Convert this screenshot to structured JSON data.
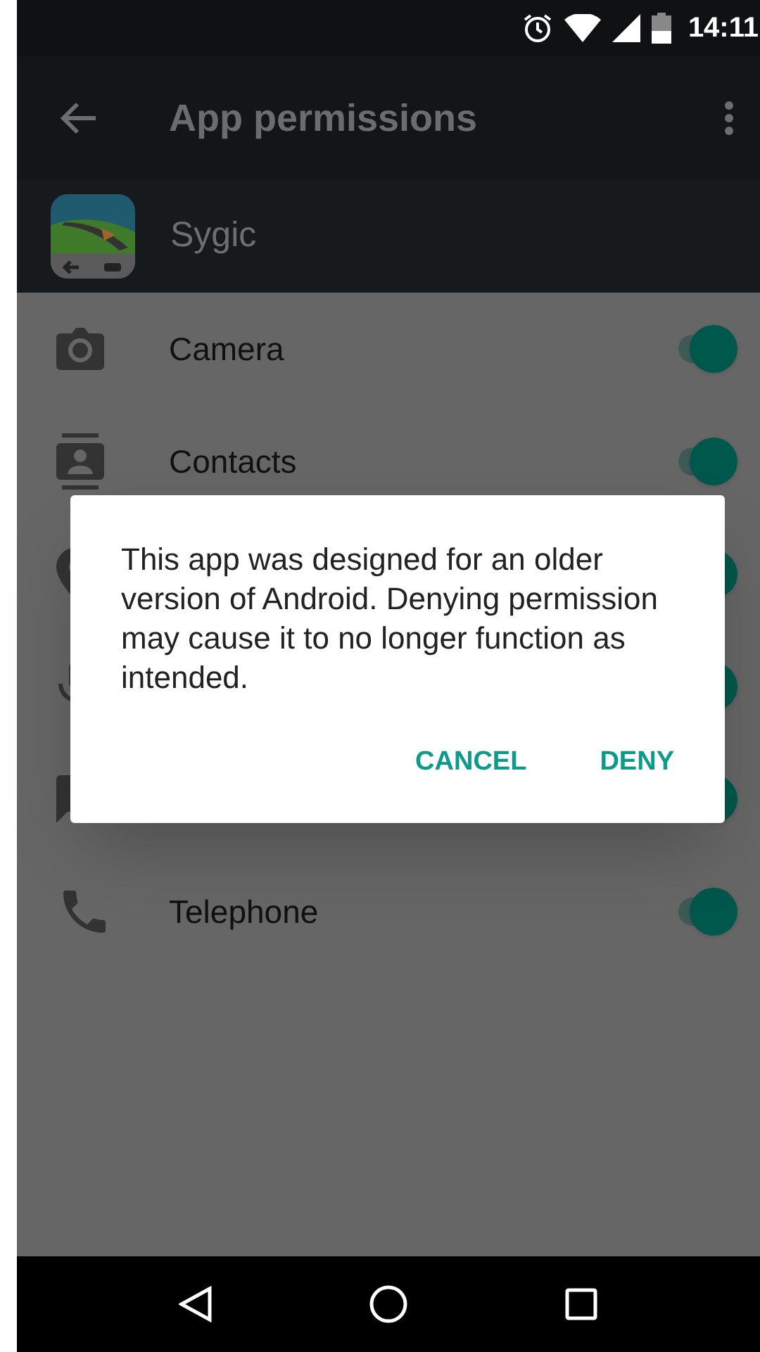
{
  "status_bar": {
    "time": "14:11"
  },
  "app_bar": {
    "title": "App permissions"
  },
  "app": {
    "name": "Sygic"
  },
  "permissions": [
    {
      "kind": "camera",
      "label": "Camera",
      "on": true
    },
    {
      "kind": "contacts",
      "label": "Contacts",
      "on": true
    },
    {
      "kind": "location",
      "on": true
    },
    {
      "kind": "microphone",
      "on": true
    },
    {
      "kind": "sms",
      "on": true
    },
    {
      "kind": "telephone",
      "label": "Telephone",
      "on": true
    }
  ],
  "dialog": {
    "message": "This app was designed for an older version of Android. Denying permission may cause it to no longer function as intended.",
    "buttons": [
      "CANCEL",
      "DENY"
    ]
  }
}
